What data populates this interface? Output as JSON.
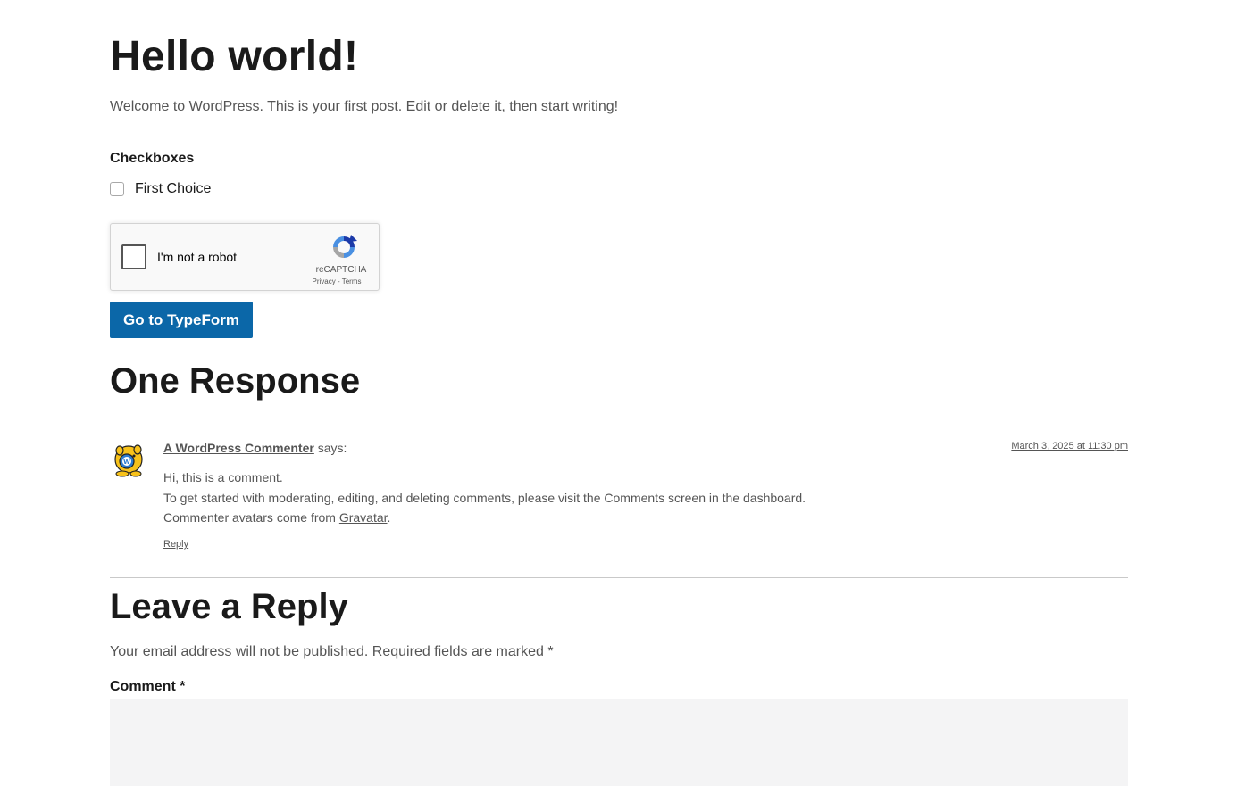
{
  "post": {
    "title": "Hello world!",
    "body": "Welcome to WordPress. This is your first post. Edit or delete it, then start writing!"
  },
  "form": {
    "checkbox_group_label": "Checkboxes",
    "checkbox_choice": "First Choice",
    "checkbox_checked": false,
    "recaptcha": {
      "label": "I'm not a robot",
      "brand": "reCAPTCHA",
      "privacy": "Privacy",
      "separator": " - ",
      "terms": "Terms"
    },
    "typeform_button": "Go to TypeForm",
    "colors": {
      "button_bg": "#0b67a8",
      "button_text": "#ffffff"
    }
  },
  "responses": {
    "heading": "One Response",
    "comments": [
      {
        "author": "A WordPress Commenter",
        "says": " says:",
        "date": "March 3, 2025 at 11:30 pm",
        "line1": "Hi, this is a comment.",
        "line2": "To get started with moderating, editing, and deleting comments, please visit the Comments screen in the dashboard.",
        "line3_prefix": "Commenter avatars come from ",
        "line3_link": "Gravatar",
        "line3_suffix": ".",
        "reply": "Reply",
        "avatar_icon": "wapuu-avatar-icon"
      }
    ]
  },
  "leave_reply": {
    "heading": "Leave a Reply",
    "notes": "Your email address will not be published. Required fields are marked *",
    "comment_label": "Comment *",
    "comment_value": ""
  }
}
